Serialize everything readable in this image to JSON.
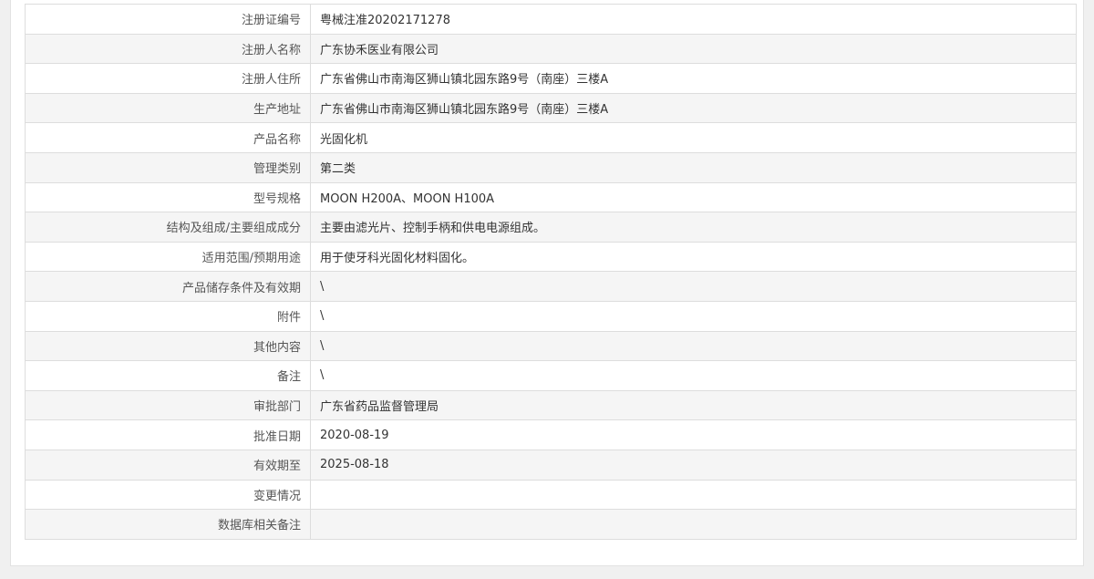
{
  "colors": {
    "page_bg": "#f0f0f0",
    "panel_bg": "#ffffff",
    "border": "#dddddd",
    "stripe": "#f5f5f5",
    "text": "#333333"
  },
  "rows": [
    {
      "label": "注册证编号",
      "value": "粤械注准20202171278"
    },
    {
      "label": "注册人名称",
      "value": "广东协禾医业有限公司"
    },
    {
      "label": "注册人住所",
      "value": "广东省佛山市南海区狮山镇北园东路9号（南座）三楼A"
    },
    {
      "label": "生产地址",
      "value": "广东省佛山市南海区狮山镇北园东路9号（南座）三楼A"
    },
    {
      "label": "产品名称",
      "value": "光固化机"
    },
    {
      "label": "管理类别",
      "value": "第二类"
    },
    {
      "label": "型号规格",
      "value": "MOON H200A、MOON H100A"
    },
    {
      "label": "结构及组成/主要组成成分",
      "value": "主要由滤光片、控制手柄和供电电源组成。"
    },
    {
      "label": "适用范围/预期用途",
      "value": "用于使牙科光固化材料固化。"
    },
    {
      "label": "产品储存条件及有效期",
      "value": "\\"
    },
    {
      "label": "附件",
      "value": "\\"
    },
    {
      "label": "其他内容",
      "value": "\\"
    },
    {
      "label": "备注",
      "value": "\\"
    },
    {
      "label": "审批部门",
      "value": "广东省药品监督管理局"
    },
    {
      "label": "批准日期",
      "value": "2020-08-19"
    },
    {
      "label": "有效期至",
      "value": "2025-08-18"
    },
    {
      "label": "变更情况",
      "value": ""
    },
    {
      "label": "数据库相关备注",
      "value": ""
    }
  ]
}
